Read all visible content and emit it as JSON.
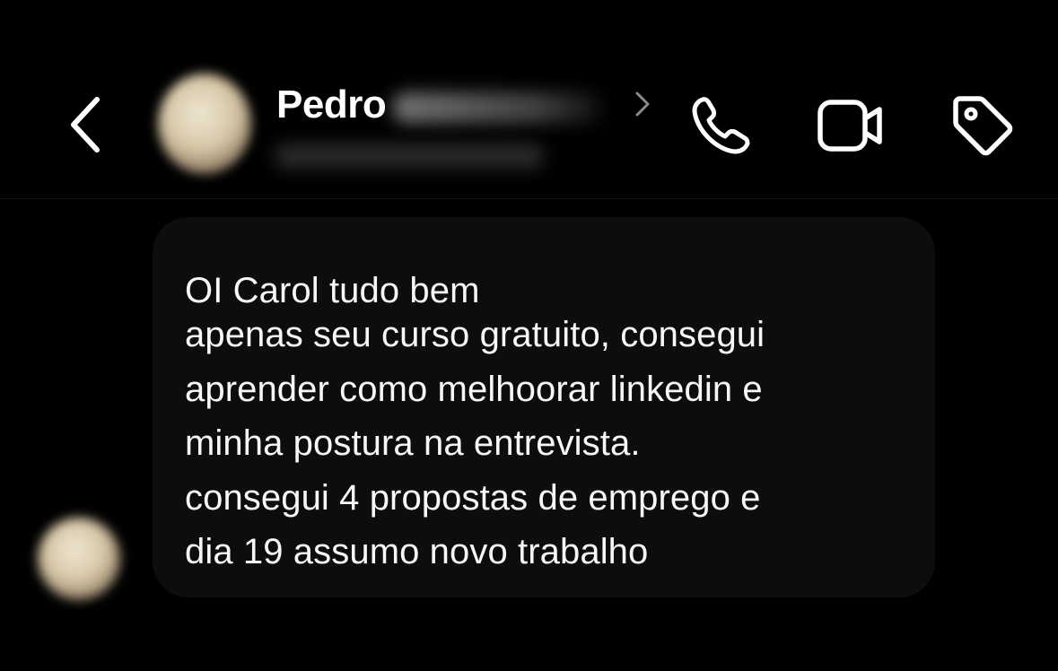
{
  "header": {
    "contact_first_name": "Pedro",
    "icons": {
      "back": "chevron-left-icon",
      "profile": "chevron-right-icon",
      "call": "phone-icon",
      "video": "video-camera-icon",
      "label": "tag-icon"
    }
  },
  "message": {
    "greeting": "OI Carol tudo bem",
    "lines": [
      "apenas seu curso gratuito, consegui",
      "aprender como melhoorar linkedin e",
      "minha postura na entrevista.",
      "consegui 4 propostas de emprego e",
      "dia 19 assumo novo trabalho"
    ]
  },
  "colors": {
    "background": "#000000",
    "bubble": "#0f0d0b",
    "text": "#f7f7f7",
    "icon": "#ffffff"
  }
}
